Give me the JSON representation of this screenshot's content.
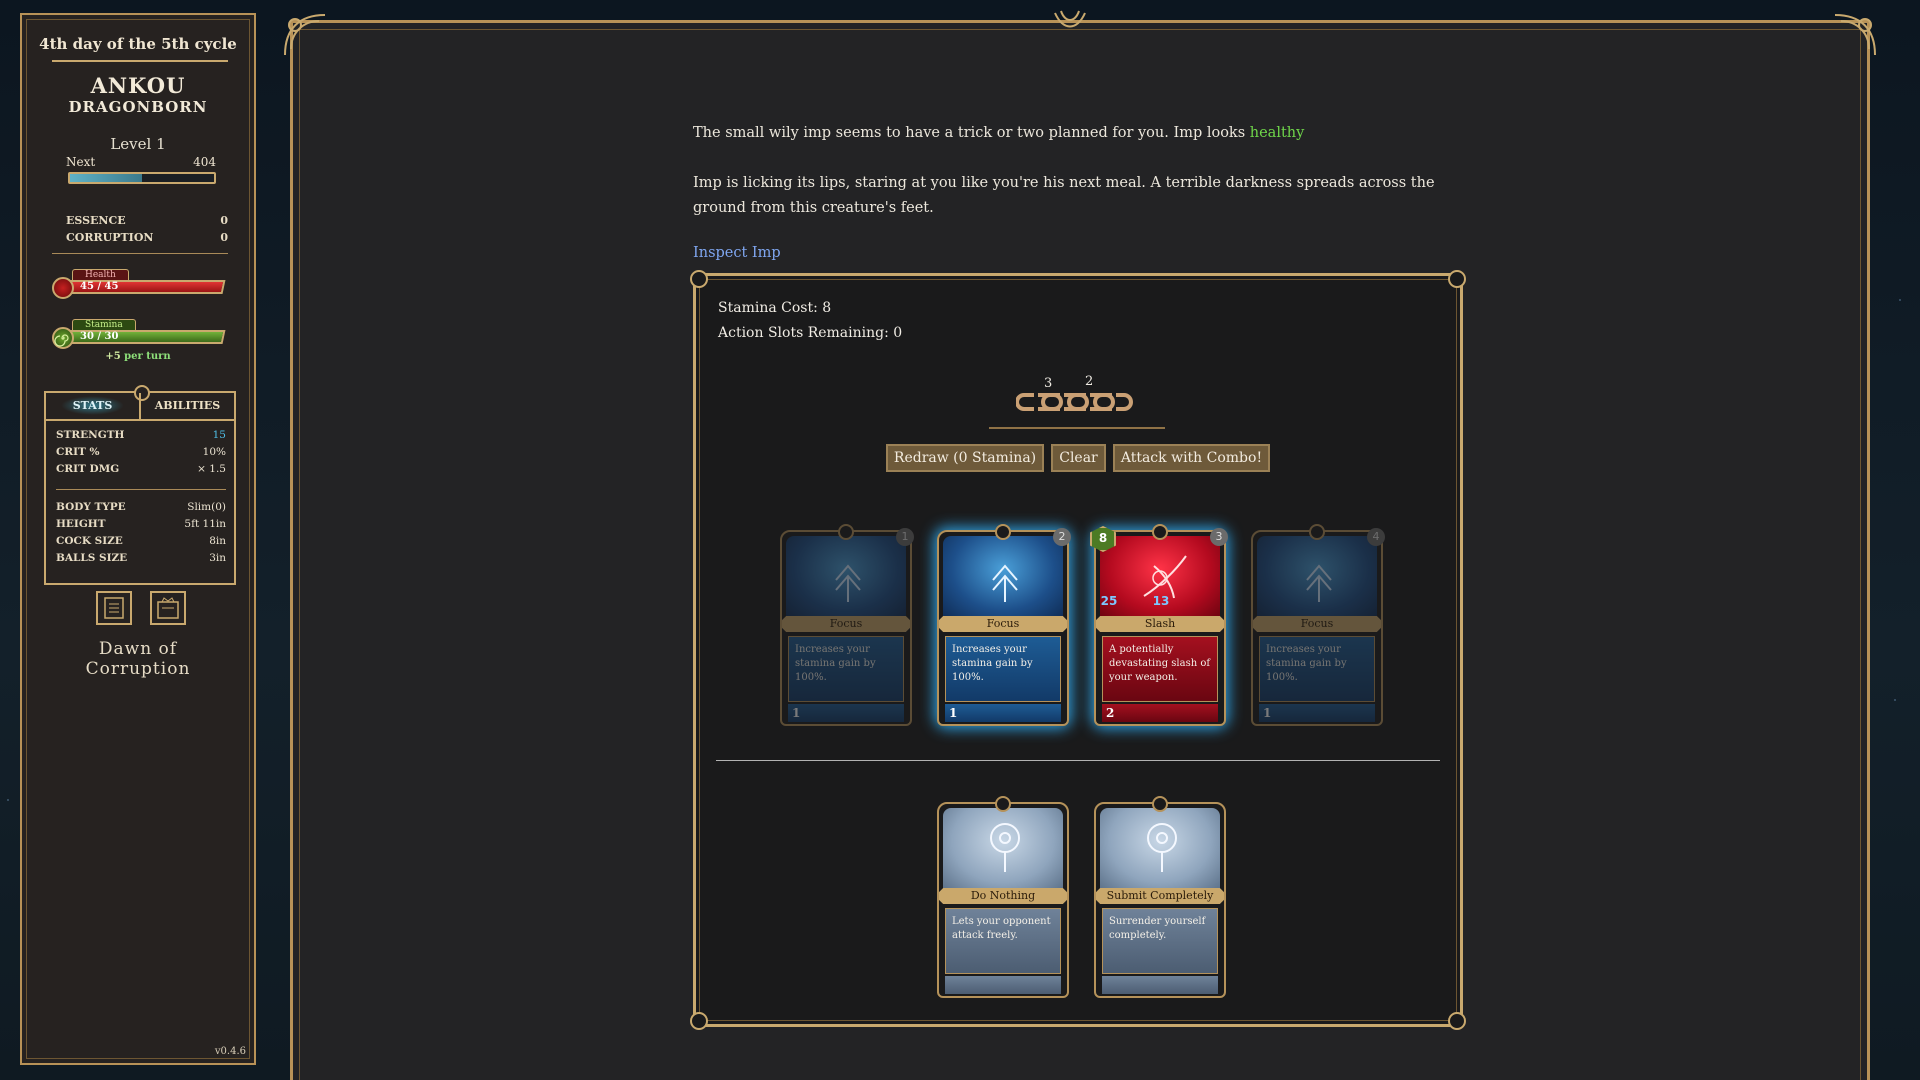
{
  "sidebar": {
    "day": "4th day of the 5th cycle",
    "name": "ANKOU",
    "race": "DRAGONBORN",
    "level": "Level 1",
    "next_label": "Next",
    "next_value": "404",
    "xp_fraction": 0.5,
    "essence_label": "ESSENCE",
    "essence_value": "0",
    "corruption_label": "CORRUPTION",
    "corruption_value": "0",
    "health_label": "Health",
    "health_value": "45 / 45",
    "health_fraction": 1.0,
    "stamina_label": "Stamina",
    "stamina_value": "30 / 30",
    "stamina_fraction": 1.0,
    "regen_amount": "+5",
    "regen_text": "per turn",
    "tabs": [
      "STATS",
      "ABILITIES"
    ],
    "stats": [
      {
        "label": "STRENGTH",
        "value": "15"
      },
      {
        "label": "CRIT %",
        "value": "10%"
      },
      {
        "label": "CRIT DMG",
        "value": "× 1.5"
      }
    ],
    "body": [
      {
        "label": "BODY TYPE",
        "value": "Slim(0)"
      },
      {
        "label": "HEIGHT",
        "value": "5ft 11in"
      },
      {
        "label": "COCK SIZE",
        "value": "8in"
      },
      {
        "label": "BALLS SIZE",
        "value": "3in"
      }
    ],
    "logo_line1": "Dawn of",
    "logo_line2": "Corruption",
    "version": "v0.4.6"
  },
  "encounter": {
    "text1_main": "The small wily imp seems to have a trick or two planned for you. Imp looks ",
    "text1_status": "healthy",
    "text2": "Imp is licking its lips, staring at you like you're his next meal. A terrible darkness spreads across the ground from this creature's feet.",
    "inspect_link": "Inspect Imp"
  },
  "combat": {
    "stamina_cost": "Stamina Cost: 8",
    "action_slots": "Action Slots Remaining: 0",
    "combo_numbers": [
      "3",
      "2"
    ],
    "buttons": {
      "redraw": "Redraw (0 Stamina)",
      "clear": "Clear",
      "attack": "Attack with Combo!"
    },
    "hand": [
      {
        "title": "Focus",
        "desc": "Increases your stamina gain by 100%.",
        "cost": "1",
        "order": "1",
        "state": "dim",
        "color": "blue"
      },
      {
        "title": "Focus",
        "desc": "Increases your stamina gain by 100%.",
        "cost": "1",
        "order": "2",
        "state": "selected",
        "color": "blue"
      },
      {
        "title": "Slash",
        "desc": "A potentially devastating slash of your weapon.",
        "cost": "2",
        "order": "3",
        "state": "selected",
        "color": "red",
        "stamina": "8",
        "stat_left": "25",
        "stat_right": "13"
      },
      {
        "title": "Focus",
        "desc": "Increases your stamina gain by 100%.",
        "cost": "1",
        "order": "4",
        "state": "dim",
        "color": "blue"
      }
    ],
    "specials": [
      {
        "title": "Do Nothing",
        "desc": "Lets your opponent attack freely."
      },
      {
        "title": "Submit Completely",
        "desc": "Surrender yourself completely."
      }
    ]
  },
  "colors": {
    "gold": "#c9a96e",
    "healthy": "#6fd64a",
    "link": "#7fa6f0",
    "card_blue": "#1d4f8a",
    "card_red": "#b40a1f"
  }
}
